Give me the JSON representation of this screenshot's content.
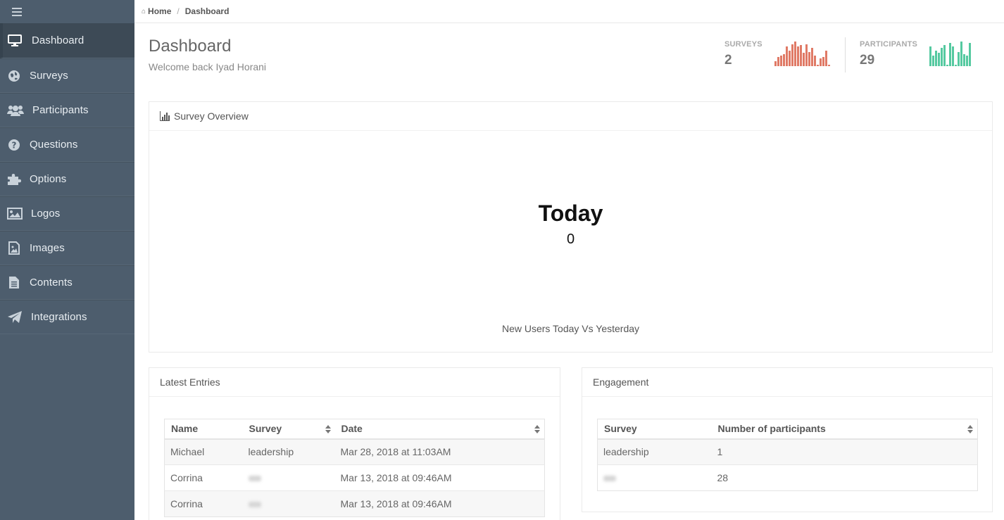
{
  "sidebar": {
    "menu_icon": "hamburger-icon",
    "items": [
      {
        "label": "Dashboard",
        "icon": "monitor-icon",
        "active": true
      },
      {
        "label": "Surveys",
        "icon": "globe-icon"
      },
      {
        "label": "Participants",
        "icon": "users-icon"
      },
      {
        "label": "Questions",
        "icon": "question-circle-icon"
      },
      {
        "label": "Options",
        "icon": "puzzle-icon"
      },
      {
        "label": "Logos",
        "icon": "picture-icon"
      },
      {
        "label": "Images",
        "icon": "image-file-icon"
      },
      {
        "label": "Contents",
        "icon": "document-icon"
      },
      {
        "label": "Integrations",
        "icon": "paper-plane-icon"
      }
    ]
  },
  "breadcrumb": {
    "home": "Home",
    "current": "Dashboard"
  },
  "header": {
    "title": "Dashboard",
    "subtitle": "Welcome back Iyad Horani"
  },
  "stats": {
    "surveys": {
      "label": "SURVEYS",
      "value": "2",
      "color": "#e07a66",
      "spark": [
        0.2,
        0.35,
        0.4,
        0.45,
        0.75,
        0.6,
        0.85,
        0.95,
        0.75,
        0.8,
        0.5,
        0.85,
        0.55,
        0.7,
        0.4,
        0.05,
        0.3,
        0.35,
        0.6,
        0.05
      ]
    },
    "participants": {
      "label": "PARTICIPANTS",
      "value": "29",
      "color": "#55c9a0",
      "spark": [
        0.75,
        0.4,
        0.6,
        0.5,
        0.7,
        0.8,
        0.05,
        0.9,
        0.75,
        0.05,
        0.55,
        0.95,
        0.45,
        0.4,
        0.9
      ]
    }
  },
  "overview": {
    "title": "Survey Overview",
    "today_label": "Today",
    "today_value": "0",
    "caption": "New Users Today Vs Yesterday"
  },
  "latest_entries": {
    "title": "Latest Entries",
    "columns": [
      "Name",
      "Survey",
      "Date"
    ],
    "rows": [
      {
        "name": "Michael",
        "survey": "leadership",
        "date": "Mar 28, 2018 at 11:03AM"
      },
      {
        "name": "Corrina",
        "survey": "",
        "date": "Mar 13, 2018 at 09:46AM"
      },
      {
        "name": "Corrina",
        "survey": "",
        "date": "Mar 13, 2018 at 09:46AM"
      }
    ]
  },
  "engagement": {
    "title": "Engagement",
    "columns": [
      "Survey",
      "Number of participants"
    ],
    "rows": [
      {
        "survey": "leadership",
        "count": "1"
      },
      {
        "survey": "",
        "count": "28"
      }
    ]
  }
}
